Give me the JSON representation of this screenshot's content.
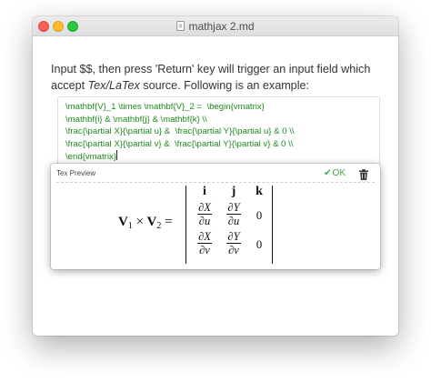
{
  "window": {
    "title": "mathjax 2.md",
    "title_icon": "document-icon"
  },
  "colors": {
    "code_green": "#1f8a1f",
    "ok_green": "#3aa545",
    "close": "#fc5f57",
    "minimize": "#fdbc2e",
    "maximize": "#29c93f"
  },
  "paragraph": {
    "part1": "Input $$, then press 'Return' key will trigger an input field which accept ",
    "emph": "Tex/LaTex",
    "part2": " source. Following is an example:"
  },
  "code_lines": [
    "\\mathbf{V}_1 \\times \\mathbf{V}_2 =  \\begin{vmatrix}",
    "\\mathbf{i} & \\mathbf{j} & \\mathbf{k} \\\\",
    "\\frac{\\partial X}{\\partial u} &  \\frac{\\partial Y}{\\partial u} & 0 \\\\",
    "\\frac{\\partial X}{\\partial v} &  \\frac{\\partial Y}{\\partial v} & 0 \\\\",
    "\\end{vmatrix}"
  ],
  "preview": {
    "label": "Tex Preview",
    "ok_label": "OK",
    "ok_icon": "checkmark-icon",
    "delete_icon": "trash-icon"
  },
  "math": {
    "lhs_v1": "V",
    "lhs_sub1": "1",
    "times": "×",
    "lhs_v2": "V",
    "lhs_sub2": "2",
    "equals": "=",
    "headers": [
      "i",
      "j",
      "k"
    ],
    "row1": {
      "dx_num": "∂X",
      "dx_den": "∂u",
      "dy_num": "∂Y",
      "dy_den": "∂u",
      "zero": "0"
    },
    "row2": {
      "dx_num": "∂X",
      "dx_den": "∂v",
      "dy_num": "∂Y",
      "dy_den": "∂v",
      "zero": "0"
    }
  }
}
